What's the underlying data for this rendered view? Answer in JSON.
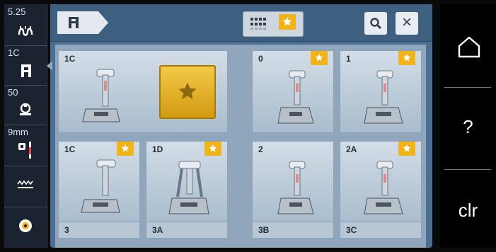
{
  "left_status": {
    "stitch_length": "5.25",
    "presser_foot": "1C",
    "tension": "50",
    "needle": "9mm"
  },
  "topbar": {
    "search_label": "search",
    "close_label": "×"
  },
  "presser_feet": [
    {
      "label": "1C",
      "favorite_big": true
    },
    {
      "label": "0",
      "starred": true
    },
    {
      "label": "1",
      "starred": true
    },
    {
      "label": "1C",
      "starred": true
    },
    {
      "label": "1D",
      "starred": true
    },
    {
      "label": "2",
      "starred": false
    },
    {
      "label": "2A",
      "starred": true
    }
  ],
  "next_row_labels": [
    "3",
    "3A",
    "3B",
    "3C"
  ],
  "right_buttons": {
    "home": "home",
    "help": "?",
    "clear": "clr"
  },
  "colors": {
    "accent_gold": "#f0b419",
    "panel_blue": "#4a6f93"
  }
}
